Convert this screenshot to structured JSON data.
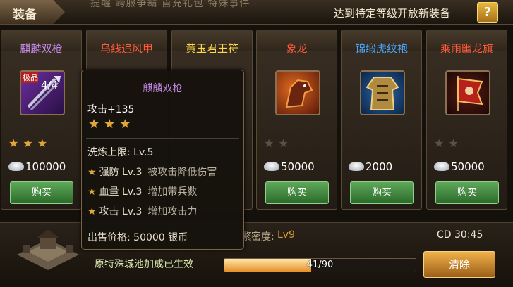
{
  "header": {
    "tab_label": "装备",
    "marquee_text": "提醒  跨服争霸 首充礼包 特殊事件",
    "notice": "达到特定等级开放新装备",
    "help_label": "?"
  },
  "items": [
    {
      "name": "麒麟双枪",
      "name_color": "#c58be8",
      "stars": 3,
      "max_stars": 3,
      "price": "100000",
      "buy_label": "购买",
      "icon": "twin-spear-icon",
      "badge": "极品",
      "count": "4/4"
    },
    {
      "name": "乌线追风甲",
      "name_color": "#ff5a3a",
      "stars": 0,
      "max_stars": 0,
      "price": "",
      "buy_label": "",
      "icon": "armor-icon"
    },
    {
      "name": "黄玉君王符",
      "name_color": "#ffd84a",
      "stars": 0,
      "max_stars": 0,
      "price": "",
      "buy_label": "",
      "icon": "talisman-icon"
    },
    {
      "name": "象龙",
      "name_color": "#ff5a3a",
      "stars": 0,
      "max_stars": 2,
      "price": "50000",
      "buy_label": "购买",
      "icon": "horse-icon"
    },
    {
      "name": "锦缎虎纹袍",
      "name_color": "#4aa8ff",
      "stars": 0,
      "max_stars": 0,
      "price": "2000",
      "buy_label": "购买",
      "icon": "robe-icon"
    },
    {
      "name": "乘雨幽龙旗",
      "name_color": "#ff5a3a",
      "stars": 0,
      "max_stars": 2,
      "price": "50000",
      "buy_label": "购买",
      "icon": "banner-icon"
    }
  ],
  "tooltip": {
    "name": "麒麟双枪",
    "attack": "攻击+135",
    "stars": 3,
    "refine_limit": "洗炼上限: Lv.5",
    "attributes": [
      {
        "label": "强防 Lv.3",
        "desc": "被攻击降低伤害"
      },
      {
        "label": "血量 Lv.3",
        "desc": "增加带兵数"
      },
      {
        "label": "攻击 Lv.3",
        "desc": "增加攻击力"
      }
    ],
    "sell_price": "出售价格: 50000 银币"
  },
  "city": {
    "bonus_text": "原特殊城池加成已生效",
    "prosperity_label": "繁密度:",
    "prosperity_level": "Lv9",
    "cooldown": "CD 30:45",
    "progress_current": 41,
    "progress_max": 90,
    "progress_text": "41/90",
    "clear_label": "清除"
  },
  "colors": {
    "buy_button": "#3f8b3c",
    "clear_button": "#d8902f",
    "star": "#e0a63a",
    "tooltip_name": "#c58be8"
  }
}
